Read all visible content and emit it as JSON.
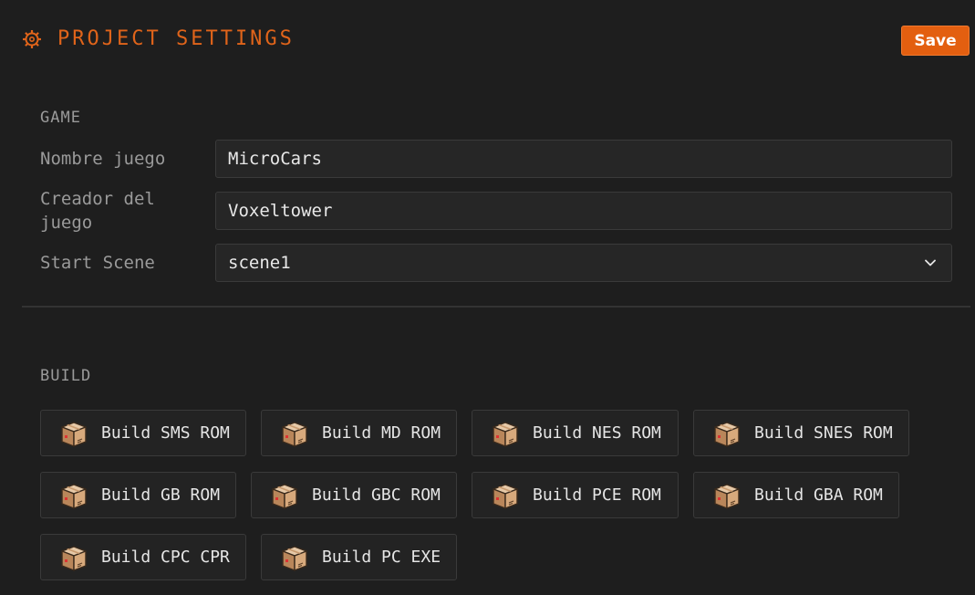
{
  "header": {
    "title": "PROJECT SETTINGS",
    "icon": "gear-icon",
    "accent_color": "#e0641a",
    "save_label": "Save"
  },
  "game": {
    "section_label": "GAME",
    "fields": [
      {
        "label": "Nombre juego",
        "value": "MicroCars"
      },
      {
        "label": "Creador del juego",
        "value": "Voxeltower"
      },
      {
        "label": "Start Scene",
        "value": "scene1"
      }
    ]
  },
  "build": {
    "section_label": "BUILD",
    "icon": "package-icon",
    "buttons": [
      "Build SMS ROM",
      "Build MD ROM",
      "Build NES ROM",
      "Build SNES ROM",
      "Build GB ROM",
      "Build GBC ROM",
      "Build PCE ROM",
      "Build GBA ROM",
      "Build CPC CPR",
      "Build PC EXE"
    ]
  }
}
